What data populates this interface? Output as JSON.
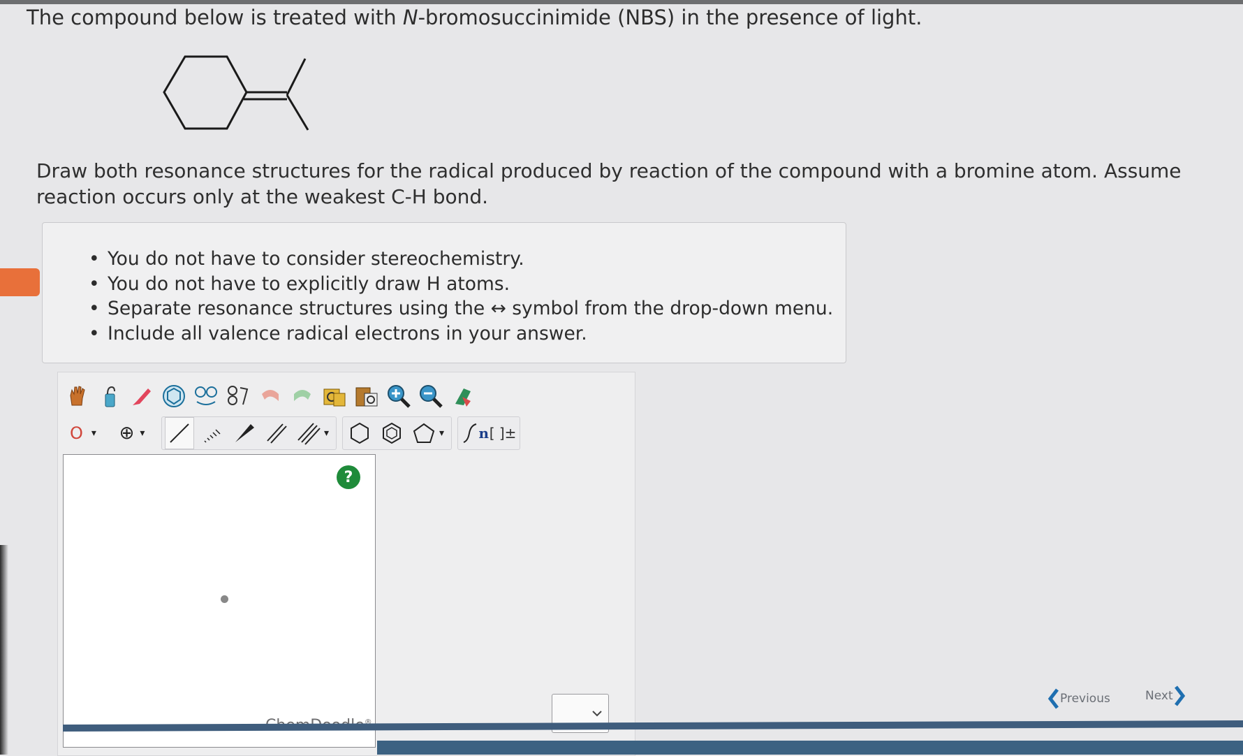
{
  "question": {
    "part1": "The compound below is treated with ",
    "italic": "N",
    "part2": "-bromosuccinimide (NBS) in the presence of light."
  },
  "prompt": "Draw both resonance structures for the radical produced by reaction of the compound with a bromine atom. Assume reaction occurs only at the weakest C-H bond.",
  "hints": [
    "You do not have to consider stereochemistry.",
    "You do not have to explicitly draw H atoms.",
    "Separate resonance structures using the ↔ symbol from the drop-down menu.",
    "Include all valence radical electrons in your answer."
  ],
  "bullet_glyph": "•",
  "toolbar": {
    "row1": [
      "hand-icon",
      "lasso-icon",
      "eraser-icon",
      "ring-template-icon",
      "template-copy-icon",
      "template-flip-icon",
      "undo-icon",
      "redo-icon",
      "copy-icon",
      "paste-icon",
      "zoom-in-icon",
      "zoom-out-icon",
      "clean-icon"
    ],
    "element_label": "O",
    "charge_label": "⊕",
    "caret": "▾",
    "sgroup_label": "n",
    "bracket_label": "[ ]±"
  },
  "help_label": "?",
  "editor_brand": "ChemDoodle",
  "editor_brand_mark": "®",
  "navigation": {
    "previous": "Previous",
    "next": "Next"
  },
  "colors": {
    "accent_orange": "#e8703a",
    "help_green": "#1f8b3a",
    "element_red": "#d0453a"
  }
}
